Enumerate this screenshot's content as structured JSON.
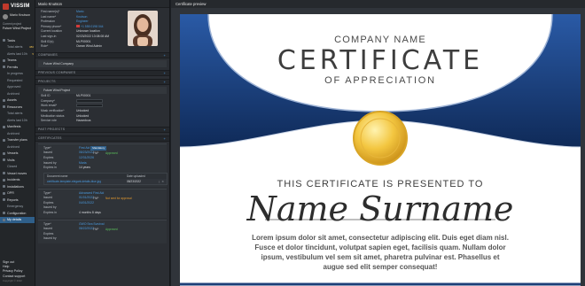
{
  "app": {
    "brand": "VISSIM",
    "user_name": "Mario Knutson",
    "current_project_label": "Current project",
    "current_project": "Future Wind Project"
  },
  "nav": [
    {
      "label": "Tasks",
      "sub": false,
      "count": ""
    },
    {
      "label": "Total alerts",
      "sub": true,
      "count": "380"
    },
    {
      "label": "Alerts last 10h",
      "sub": true,
      "count": "5"
    },
    {
      "label": "Teams",
      "sub": false,
      "count": ""
    },
    {
      "label": "Permits",
      "sub": false,
      "count": ""
    },
    {
      "label": "In progress",
      "sub": true,
      "count": ""
    },
    {
      "label": "Requested",
      "sub": true,
      "count": ""
    },
    {
      "label": "Approved",
      "sub": true,
      "count": ""
    },
    {
      "label": "Archived",
      "sub": true,
      "count": ""
    },
    {
      "label": "Assets",
      "sub": false,
      "count": ""
    },
    {
      "label": "Resources",
      "sub": false,
      "count": ""
    },
    {
      "label": "Total alerts",
      "sub": true,
      "count": ""
    },
    {
      "label": "Alerts last 10h",
      "sub": true,
      "count": ""
    },
    {
      "label": "Manifests",
      "sub": false,
      "count": ""
    },
    {
      "label": "Archived",
      "sub": true,
      "count": ""
    },
    {
      "label": "Transfer plans",
      "sub": false,
      "count": ""
    },
    {
      "label": "Archived",
      "sub": true,
      "count": ""
    },
    {
      "label": "Vessels",
      "sub": false,
      "count": ""
    },
    {
      "label": "Visits",
      "sub": false,
      "count": ""
    },
    {
      "label": "Closed",
      "sub": true,
      "count": ""
    },
    {
      "label": "Vessel moves",
      "sub": false,
      "count": ""
    },
    {
      "label": "Incidents",
      "sub": false,
      "count": ""
    },
    {
      "label": "Installations",
      "sub": false,
      "count": ""
    },
    {
      "label": "OPR",
      "sub": false,
      "count": ""
    },
    {
      "label": "Reports",
      "sub": false,
      "count": ""
    },
    {
      "label": "Emergency",
      "sub": true,
      "count": ""
    },
    {
      "label": "Configuration",
      "sub": false,
      "count": ""
    },
    {
      "label": "My details",
      "sub": false,
      "count": "",
      "selected": true
    }
  ],
  "bottom": {
    "sign_out": "Sign out",
    "help": "Help",
    "privacy": "Privacy Policy",
    "contact": "Contact support",
    "copyright": "Copyright © 2022"
  },
  "panel": {
    "title": "Mario Knutson",
    "fields": [
      {
        "k": "First name(s)*",
        "v": "Mario",
        "cls": "link"
      },
      {
        "k": "Last name*",
        "v": "Knutson",
        "cls": "link"
      },
      {
        "k": "Profession",
        "v": "Engineer",
        "cls": "link"
      },
      {
        "k": "Primary phone*",
        "v": "+1 555 0198 044",
        "cls": "link flag"
      },
      {
        "k": "Current location",
        "v": "Unknown location",
        "cls": ""
      },
      {
        "k": "Last sign-in",
        "v": "02/23/2022 13:08:08 AM",
        "cls": ""
      },
      {
        "k": "Skill ID(s)",
        "v": "MLP00001",
        "cls": ""
      },
      {
        "k": "Role*",
        "v": "Ocean Wind Admin",
        "cls": ""
      }
    ],
    "sec_companies": "COMPANIES",
    "company": "Future Wind Company",
    "sec_prev_companies": "PREVIOUS COMPANIES",
    "sec_projects": "PROJECTS",
    "project": "Future Wind Project",
    "project_fields": [
      {
        "k": "Skill ID",
        "v": "MLP00001",
        "cls": ""
      },
      {
        "k": "Company*",
        "v": "",
        "cls": "input"
      },
      {
        "k": "Work email*",
        "v": "",
        "cls": "input"
      },
      {
        "k": "Mask verification*",
        "v": "Unlocked",
        "cls": "green"
      },
      {
        "k": "Medication status",
        "v": "Unlocked",
        "cls": "green"
      },
      {
        "k": "Service role",
        "v": "Hazardous",
        "cls": ""
      }
    ],
    "sec_past_projects": "PAST PROJECTS",
    "sec_certificates": "CERTIFICATES",
    "certs": [
      {
        "type_k": "Type*",
        "type_v": "First Aid",
        "tag": "Mandatory",
        "status": "Approved",
        "status_cls": "green",
        "fnp": "FNP",
        "issued_k": "Issued",
        "issued_v": "08/23/2022",
        "exp_k": "Expires",
        "exp_v": "12/31/2026",
        "by_k": "Issued by",
        "by_v": "Maria",
        "in_k": "Expires in",
        "in_v": "14 years",
        "doc_head": "Document name",
        "date_head": "Date uploaded",
        "doc_name": "certificate-template-elegant-details-blue.jpg",
        "doc_date": "08/23/2022"
      },
      {
        "type_k": "Type*",
        "type_v": "Advanced First Aid",
        "tag": "",
        "status": "Not sent for approval",
        "status_cls": "orange",
        "fnp": "FNP",
        "issued_k": "Issued",
        "issued_v": "01/01/2022",
        "exp_k": "Expires",
        "exp_v": "04/01/2022",
        "by_k": "Issued by",
        "by_v": "",
        "in_k": "Expires in",
        "in_v": "4 months 8 days"
      },
      {
        "type_k": "Type*",
        "type_v": "GWO Sea Survival",
        "tag": "",
        "status": "Approved",
        "status_cls": "green",
        "fnp": "FNP",
        "issued_k": "Issued",
        "issued_v": "08/22/2022",
        "exp_k": "Expires",
        "exp_v": "",
        "by_k": "Issued by",
        "by_v": "",
        "in_k": "",
        "in_v": ""
      }
    ]
  },
  "preview": {
    "header": "Certificate preview",
    "company": "COMPANY NAME",
    "title": "CERTIFICATE",
    "subtitle": "OF APPRECIATION",
    "presented": "THIS CERTIFICATE IS PRESENTED TO",
    "name": "Name Surname",
    "body": "Lorem ipsum dolor sit amet, consectetur adipiscing elit. Duis eget diam nisl. Fusce et dolor tincidunt, volutpat sapien eget, facilisis quam. Nullam dolor ipsum, vestibulum vel sem sit amet, pharetra pulvinar est. Phasellus et augue sed elit semper consequat!",
    "accent": "#1d3f78"
  }
}
